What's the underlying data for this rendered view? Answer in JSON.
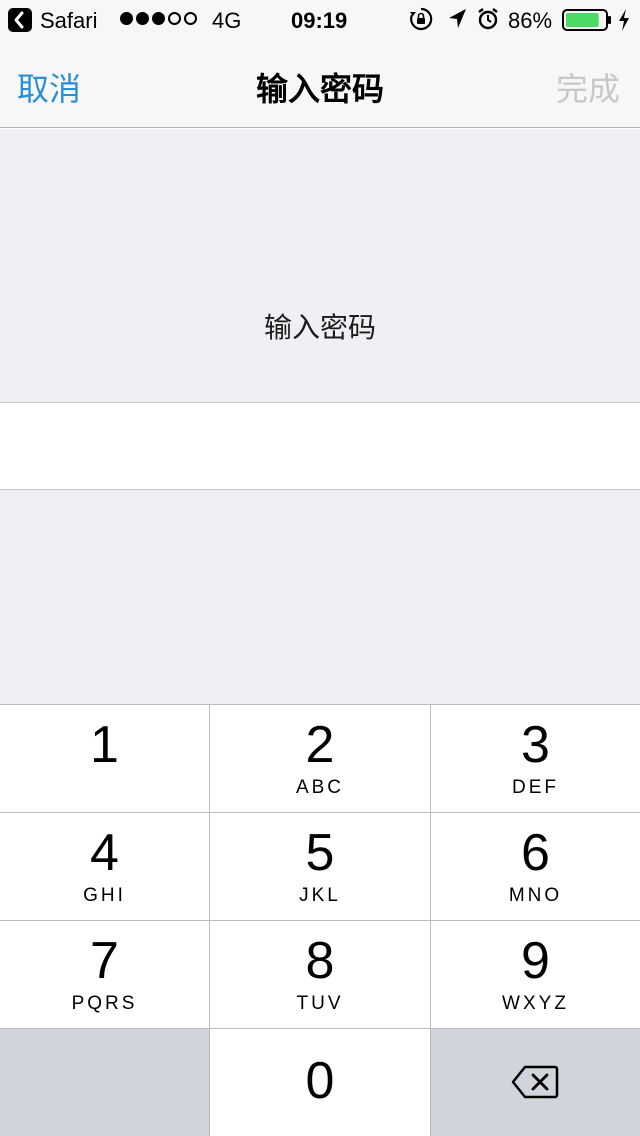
{
  "status_bar": {
    "back_app": "Safari",
    "signal_dots": [
      true,
      true,
      true,
      false,
      false
    ],
    "network": "4G",
    "time": "09:19",
    "battery_percent": "86%",
    "battery_level": 0.86,
    "battery_color": "#4cd964",
    "icons": [
      "back-arrow-icon",
      "rotation-lock-icon",
      "location-arrow-icon",
      "alarm-clock-icon",
      "battery-icon",
      "charging-bolt-icon"
    ]
  },
  "nav": {
    "cancel_label": "取消",
    "title": "输入密码",
    "done_label": "完成",
    "accent_color": "#2b8fd6",
    "disabled_color": "#c7c7cc"
  },
  "prompt": {
    "text": "输入密码"
  },
  "password_field": {
    "value": "",
    "placeholder": ""
  },
  "keypad": {
    "keys": [
      {
        "digit": "1",
        "letters": ""
      },
      {
        "digit": "2",
        "letters": "ABC"
      },
      {
        "digit": "3",
        "letters": "DEF"
      },
      {
        "digit": "4",
        "letters": "GHI"
      },
      {
        "digit": "5",
        "letters": "JKL"
      },
      {
        "digit": "6",
        "letters": "MNO"
      },
      {
        "digit": "7",
        "letters": "PQRS"
      },
      {
        "digit": "8",
        "letters": "TUV"
      },
      {
        "digit": "9",
        "letters": "WXYZ"
      },
      {
        "digit": "0",
        "letters": ""
      }
    ],
    "delete_icon": "backspace-icon"
  }
}
